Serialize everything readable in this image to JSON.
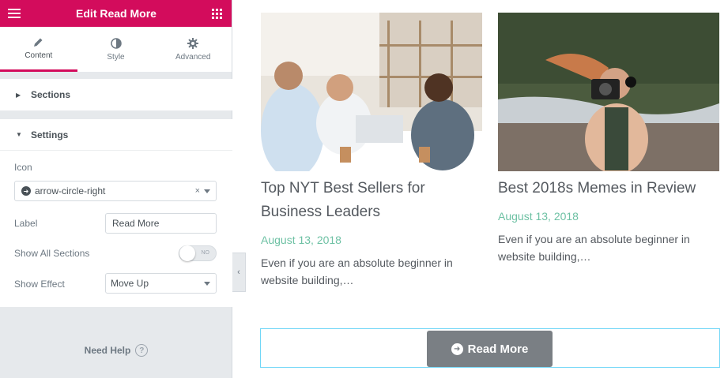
{
  "panel": {
    "title": "Edit Read More",
    "tabs": [
      {
        "label": "Content",
        "icon": "pencil-icon"
      },
      {
        "label": "Style",
        "icon": "half-circle-icon"
      },
      {
        "label": "Advanced",
        "icon": "gear-icon"
      }
    ],
    "sections_label": "Sections",
    "settings_label": "Settings",
    "controls": {
      "icon_label": "Icon",
      "icon_value": "arrow-circle-right",
      "label_label": "Label",
      "label_value": "Read More",
      "show_all_label": "Show All Sections",
      "show_all_value": "NO",
      "effect_label": "Show Effect",
      "effect_value": "Move Up"
    },
    "need_help": "Need Help",
    "accent": "#d30c5c"
  },
  "posts": [
    {
      "title": "Top NYT Best Sellers for Business Leaders",
      "date": "August 13, 2018",
      "excerpt": "Even if you are an absolute beginner in website building,…"
    },
    {
      "title": "Best 2018s Memes in Review",
      "date": "August 13, 2018",
      "excerpt": "Even if you are an absolute beginner in website building,…"
    }
  ],
  "read_more_button": "Read More",
  "colors": {
    "date": "#6ec1a4",
    "button": "#7a7f84",
    "selection": "#71d7f7"
  }
}
